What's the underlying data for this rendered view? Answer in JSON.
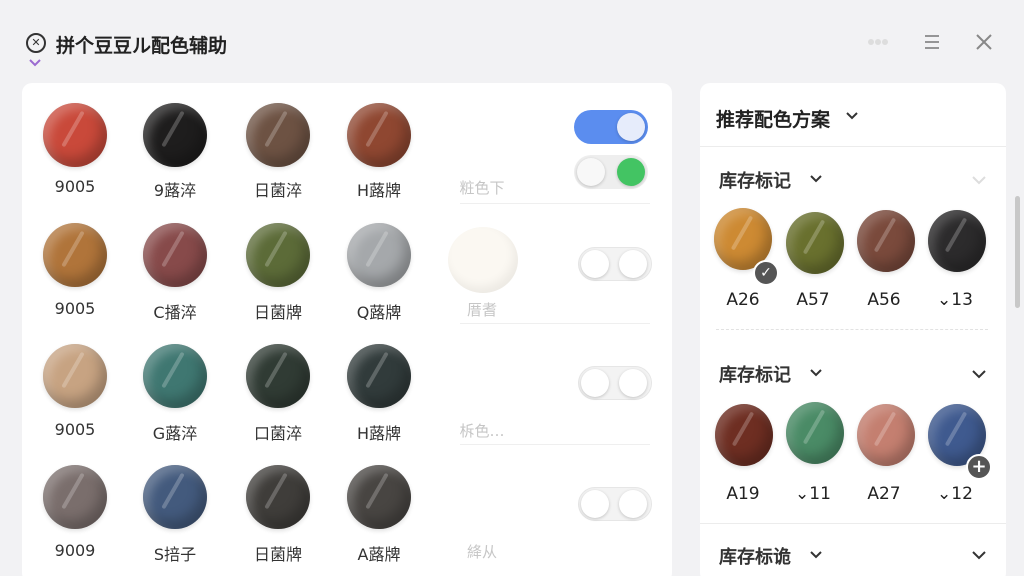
{
  "app": {
    "title": "拼个豆豆ル配色辅助",
    "icon": "bead-logo-icon",
    "controls": [
      "more-icon",
      "menu-icon",
      "close-icon"
    ]
  },
  "palette": {
    "rows": [
      {
        "swatches": [
          {
            "label": "9005",
            "color": "#c9493a"
          },
          {
            "label": "9蕗淬",
            "color": "#1e1d1d"
          },
          {
            "label": "日菌淬",
            "color": "#6d5243"
          },
          {
            "label": "H蕗牌",
            "color": "#8f4731"
          },
          {
            "label": "粧色下",
            "color": null
          }
        ],
        "toggles": [
          {
            "state": "on",
            "color": "#5b8def"
          },
          {
            "state": "on",
            "color": "#43c463"
          }
        ]
      },
      {
        "swatches": [
          {
            "label": "9005",
            "color": "#b0743a"
          },
          {
            "label": "C播淬",
            "color": "#874a4a"
          },
          {
            "label": "日菌牌",
            "color": "#5c6b38"
          },
          {
            "label": "Q蕗牌",
            "color": "#a5a8ab"
          },
          {
            "label": "厝耆",
            "color": "#fbf8f2"
          }
        ],
        "toggles": [
          {
            "state": "off"
          }
        ]
      },
      {
        "swatches": [
          {
            "label": "9005",
            "color": "#c7a382"
          },
          {
            "label": "G蕗淬",
            "color": "#3f7771"
          },
          {
            "label": "口菌淬",
            "color": "#303b34"
          },
          {
            "label": "H蕗牌",
            "color": "#313b3b"
          },
          {
            "label": "柝色…",
            "color": null
          }
        ],
        "toggles": [
          {
            "state": "off"
          }
        ]
      },
      {
        "swatches": [
          {
            "label": "9009",
            "color": "#7a6e6c"
          },
          {
            "label": "S掊子",
            "color": "#435a7d"
          },
          {
            "label": "日菌牌",
            "color": "#3f3d3a"
          },
          {
            "label": "A蕗牌",
            "color": "#484542"
          },
          {
            "label": "絳从",
            "color": null
          }
        ],
        "toggles": [
          {
            "state": "off"
          }
        ]
      }
    ]
  },
  "recommend": {
    "title": "推荐配色方案",
    "sections": [
      {
        "title": "库存标记",
        "beads": [
          {
            "label": "A26",
            "color": "#cd8a33",
            "badge": "check"
          },
          {
            "label": "A57",
            "color": "#69702e"
          },
          {
            "label": "A56",
            "color": "#7a4a3c"
          },
          {
            "label": "⌄13",
            "color": "#2c2b2c"
          }
        ]
      },
      {
        "title": "库存标记",
        "beads": [
          {
            "label": "A19",
            "color": "#6e2e22"
          },
          {
            "label": "⌄11",
            "color": "#4a8b66"
          },
          {
            "label": "A27",
            "color": "#c47f70"
          },
          {
            "label": "⌄12",
            "color": "#3f5a8f",
            "badge": "plus"
          }
        ]
      },
      {
        "title": "库存标诡",
        "beads": []
      }
    ]
  }
}
